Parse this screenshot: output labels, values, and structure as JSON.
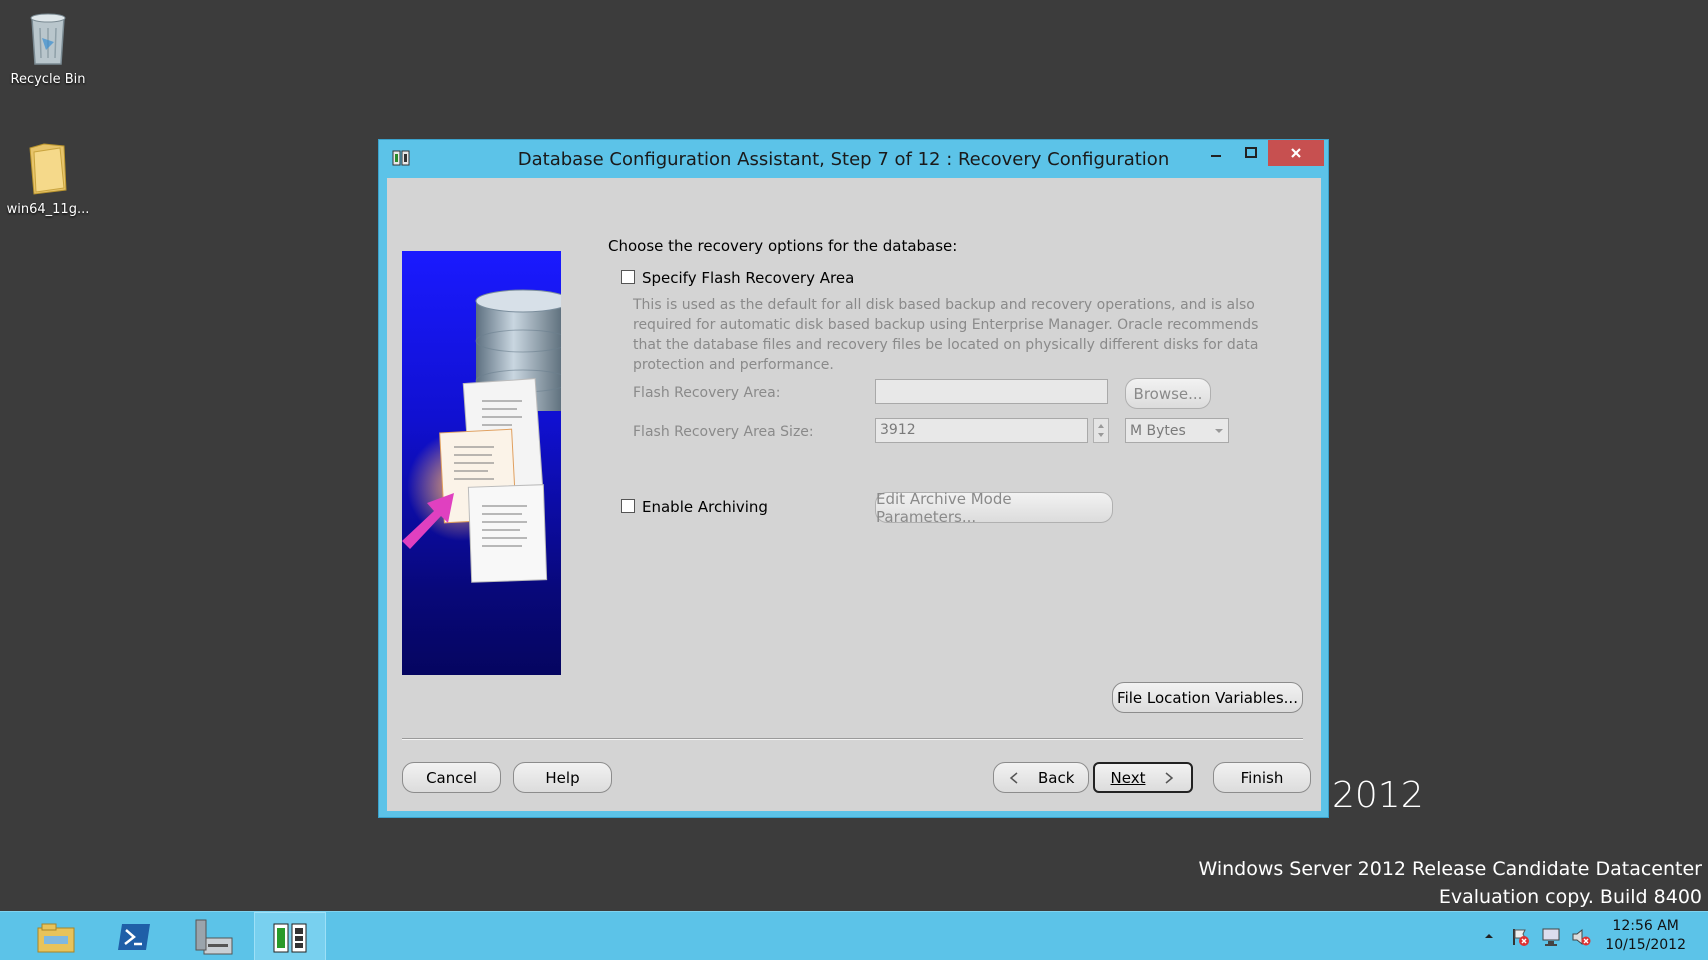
{
  "desktop": {
    "icons": [
      {
        "label": "Recycle Bin"
      },
      {
        "label": "win64_11g..."
      }
    ],
    "brand_year": "2012",
    "os_line1": "Windows Server 2012 Release Candidate Datacenter",
    "os_line2": "Evaluation copy. Build 8400"
  },
  "window": {
    "title": "Database Configuration Assistant, Step 7 of 12 : Recovery Configuration",
    "intro": "Choose the recovery options for the database:",
    "flash_checkbox_label": "Specify Flash Recovery Area",
    "flash_checked": false,
    "flash_description": "This is used as the default for all disk based backup and recovery operations, and is also required for automatic disk based backup using Enterprise Manager. Oracle recommends that the database files and recovery files be located on physically different disks for data protection and performance.",
    "flash_area_label": "Flash Recovery Area:",
    "flash_area_value": "",
    "browse_label": "Browse...",
    "flash_size_label": "Flash Recovery Area Size:",
    "flash_size_value": "3912",
    "flash_size_unit": "M Bytes",
    "archiving_label": "Enable Archiving",
    "archiving_checked": false,
    "edit_archive_label": "Edit Archive Mode Parameters...",
    "file_location_label": "File Location Variables...",
    "cancel_label": "Cancel",
    "help_label": "Help",
    "back_label": "Back",
    "next_label": "Next",
    "finish_label": "Finish"
  },
  "taskbar": {
    "time": "12:56 AM",
    "date": "10/15/2012"
  },
  "colors": {
    "window_frame": "#5cc3e8",
    "close_button": "#c75050",
    "dialog_background": "#d4d4d4",
    "desktop": "#3c3c3c"
  }
}
